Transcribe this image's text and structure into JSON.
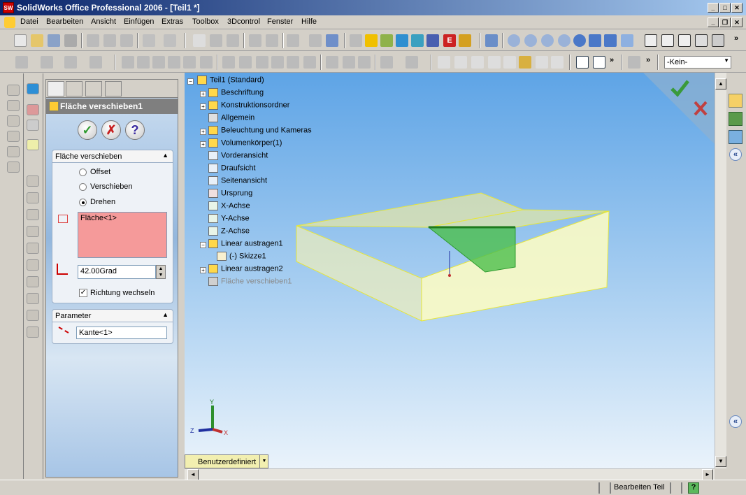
{
  "window": {
    "title": "SolidWorks Office Professional 2006 - [Teil1 *]",
    "app_icon_text": "SW"
  },
  "menu": {
    "items": [
      "Datei",
      "Bearbeiten",
      "Ansicht",
      "Einfügen",
      "Extras",
      "Toolbox",
      "3Dcontrol",
      "Fenster",
      "Hilfe"
    ]
  },
  "toolbar": {
    "display_dropdown": "-Kein-",
    "overflow": "»"
  },
  "propertymanager": {
    "title": "Fläche verschieben1",
    "ok": "✓",
    "cancel": "✗",
    "help": "?",
    "group1": {
      "title": "Fläche verschieben",
      "options": [
        {
          "label": "Offset",
          "selected": false
        },
        {
          "label": "Verschieben",
          "selected": false
        },
        {
          "label": "Drehen",
          "selected": true
        }
      ],
      "selection": "Fläche<1>",
      "angle": "42.00Grad",
      "reverse_label": "Richtung wechseln",
      "reverse_checked": true
    },
    "group2": {
      "title": "Parameter",
      "edge": "Kante<1>"
    }
  },
  "tree": {
    "root": "Teil1  (Standard)",
    "items": [
      {
        "label": "Beschriftung",
        "icon": "annotation-icon",
        "expandable": true
      },
      {
        "label": "Konstruktionsordner",
        "icon": "folder-icon",
        "expandable": true
      },
      {
        "label": "Allgemein",
        "icon": "material-icon",
        "expandable": false
      },
      {
        "label": "Beleuchtung und Kameras",
        "icon": "lights-icon",
        "expandable": true
      },
      {
        "label": "Volumenkörper(1)",
        "icon": "solid-bodies-icon",
        "expandable": true
      },
      {
        "label": "Vorderansicht",
        "icon": "plane-icon",
        "expandable": false
      },
      {
        "label": "Draufsicht",
        "icon": "plane-icon",
        "expandable": false
      },
      {
        "label": "Seitenansicht",
        "icon": "plane-icon",
        "expandable": false
      },
      {
        "label": "Ursprung",
        "icon": "origin-icon",
        "expandable": false
      },
      {
        "label": "X-Achse",
        "icon": "axis-icon",
        "expandable": false
      },
      {
        "label": "Y-Achse",
        "icon": "axis-icon",
        "expandable": false
      },
      {
        "label": "Z-Achse",
        "icon": "axis-icon",
        "expandable": false
      },
      {
        "label": "Linear austragen1",
        "icon": "extrude-icon",
        "expandable": true
      },
      {
        "label": "(-) Skizze1",
        "icon": "sketch-icon",
        "expandable": false,
        "child": true
      },
      {
        "label": "Linear austragen2",
        "icon": "extrude-icon",
        "expandable": true
      },
      {
        "label": "Fläche verschieben1",
        "icon": "move-face-icon",
        "expandable": false,
        "ghost": true
      }
    ]
  },
  "viewport": {
    "config_dropdown": "Benutzerdefiniert",
    "triad": {
      "x": "X",
      "y": "Y",
      "z": "Z"
    }
  },
  "statusbar": {
    "mode": "Bearbeiten Teil",
    "help": "?"
  },
  "colors": {
    "accent": "#0a246a",
    "ok": "#2e9a2e",
    "cancel": "#c62020",
    "selection": "#f59a9a"
  }
}
